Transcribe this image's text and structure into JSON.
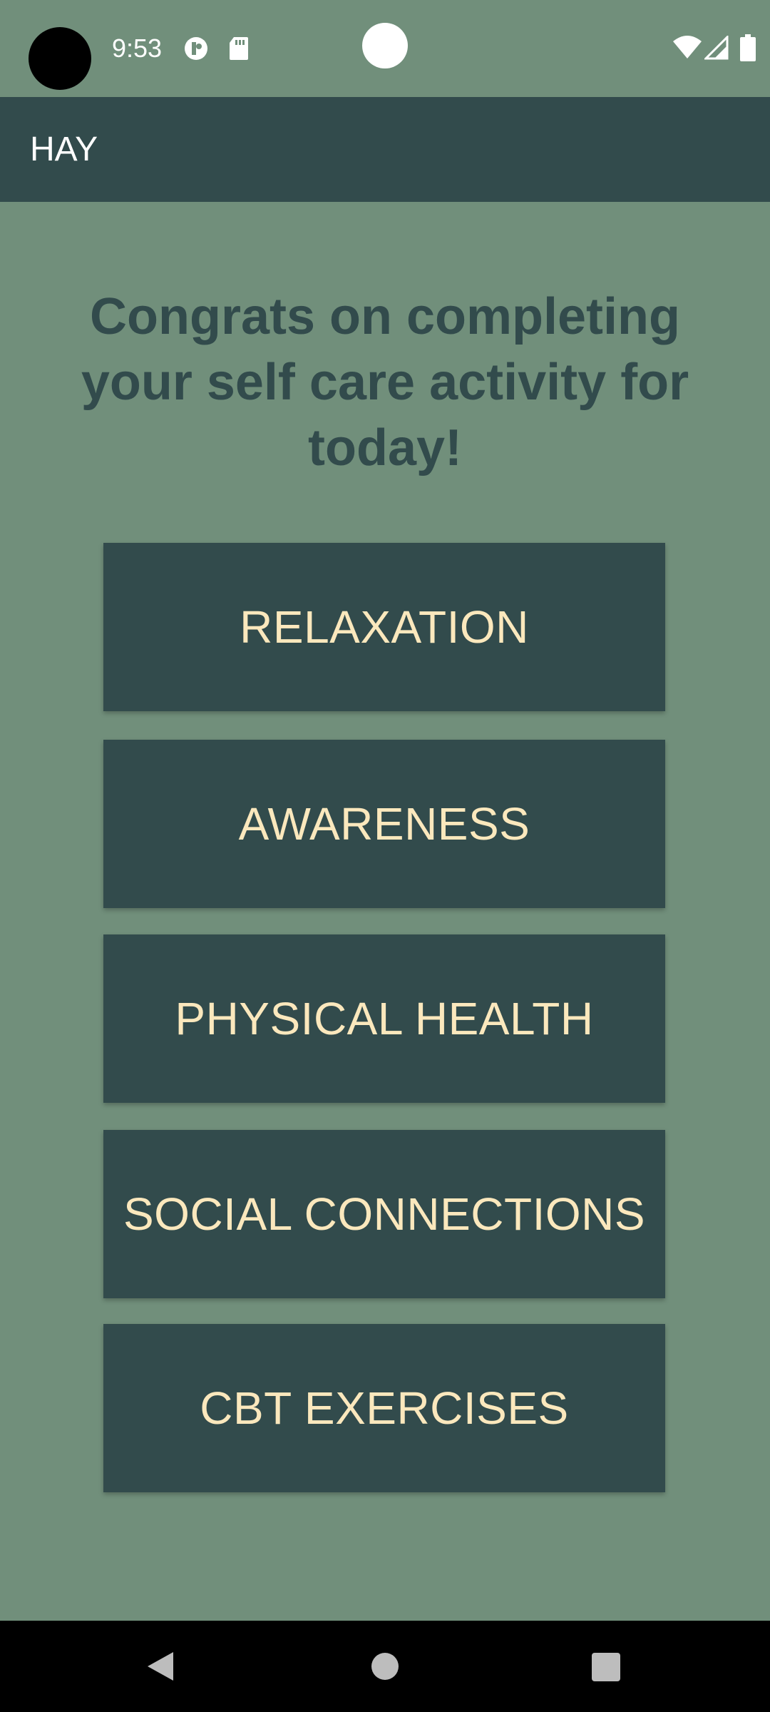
{
  "status_bar": {
    "time": "9:53",
    "icons": [
      "camera-cutout",
      "data-saver-icon",
      "sd-card-icon",
      "wifi-icon",
      "cell-signal-icon",
      "battery-icon"
    ]
  },
  "app_bar": {
    "title": "HAY"
  },
  "main": {
    "message": "Congrats on completing your self care activity for today!",
    "buttons": [
      {
        "label": "RELAXATION"
      },
      {
        "label": "AWARENESS"
      },
      {
        "label": "PHYSICAL HEALTH"
      },
      {
        "label": "SOCIAL CONNECTIONS"
      },
      {
        "label": "CBT EXERCISES"
      }
    ]
  },
  "nav_bar": {
    "icons": [
      "back-icon",
      "home-icon",
      "recents-icon"
    ]
  },
  "colors": {
    "background": "#718f7b",
    "primary_dark": "#324b4c",
    "button_text": "#fbe8bd",
    "app_title_text": "#ffffff"
  }
}
